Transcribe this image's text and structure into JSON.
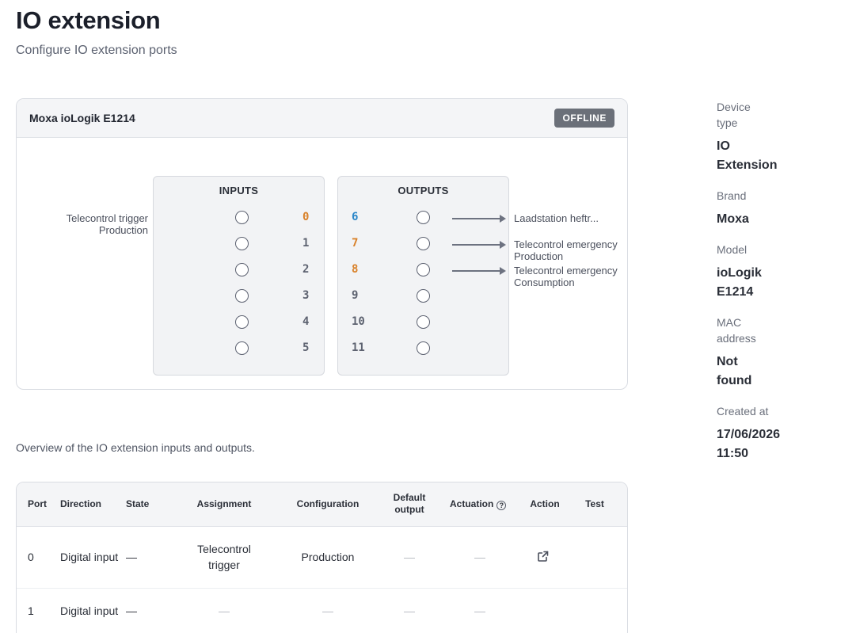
{
  "page": {
    "title": "IO extension",
    "subtitle": "Configure IO extension ports"
  },
  "device": {
    "name": "Moxa ioLogik E1214",
    "status": "OFFLINE"
  },
  "io": {
    "inputs_title": "INPUTS",
    "outputs_title": "OUTPUTS",
    "input_ports": [
      "0",
      "1",
      "2",
      "3",
      "4",
      "5"
    ],
    "output_ports": [
      "6",
      "7",
      "8",
      "9",
      "10",
      "11"
    ],
    "input_labels": {
      "line1": "Telecontrol trigger",
      "line2": "Production"
    },
    "output_labels": [
      {
        "line1": "Laadstation heftr...",
        "line2": ""
      },
      {
        "line1": "Telecontrol emergency",
        "line2": "Production"
      },
      {
        "line1": "Telecontrol emergency",
        "line2": "Consumption"
      }
    ],
    "colors": {
      "assigned_input": "#d9822b",
      "assigned_output_blue": "#2a86c9",
      "assigned_output_orange": "#d9822b"
    }
  },
  "overview_text": "Overview of the IO extension inputs and outputs.",
  "table": {
    "headers": {
      "port": "Port",
      "direction": "Direction",
      "state": "State",
      "assignment": "Assignment",
      "configuration": "Configuration",
      "default_output_1": "Default",
      "default_output_2": "output",
      "actuation": "Actuation",
      "actuation_help": "?",
      "action": "Action",
      "test": "Test"
    },
    "rows": [
      {
        "port": "0",
        "direction": "Digital input",
        "state": "—",
        "assignment_1": "Telecontrol",
        "assignment_2": "trigger",
        "configuration": "Production",
        "default_output": "—",
        "actuation": "—",
        "action_icon": "external-link-icon",
        "test": ""
      },
      {
        "port": "1",
        "direction": "Digital input",
        "state": "—",
        "assignment": "—",
        "configuration": "—",
        "default_output": "—",
        "actuation": "—",
        "test": ""
      }
    ]
  },
  "details": {
    "device_type_label_1": "Device",
    "device_type_label_2": "type",
    "device_type_1": "IO",
    "device_type_2": "Extension",
    "brand_label": "Brand",
    "brand": "Moxa",
    "model_label": "Model",
    "model_1": "ioLogik",
    "model_2": "E1214",
    "mac_label_1": "MAC",
    "mac_label_2": "address",
    "mac_1": "Not",
    "mac_2": "found",
    "created_label": "Created at",
    "created_date": "17/06/2026",
    "created_time": "11:50"
  }
}
